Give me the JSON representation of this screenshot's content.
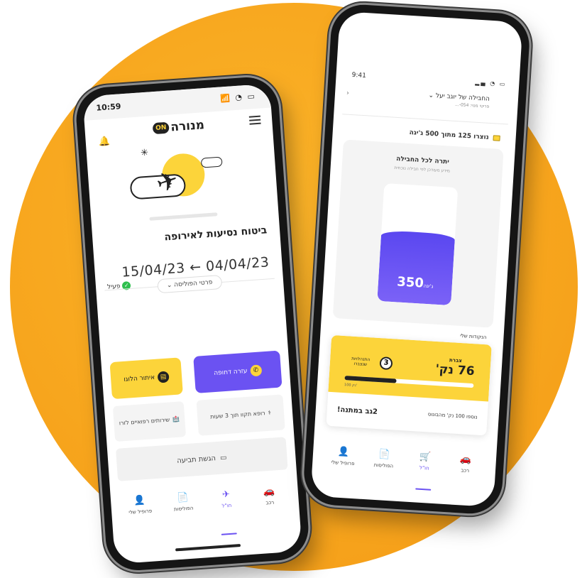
{
  "left": {
    "time": "10:59",
    "status_icons": "📶 ◔ ▭",
    "brand_name": "מנורה",
    "brand_badge": "ON",
    "policy_title": "ביטוח נסיעות לאירופה",
    "status_label": "פעיל",
    "dates": "15/04/23 ← 04/04/23",
    "policy_details": "פרטי הפוליסה ⌄",
    "urgent_help": "עזרה דחופה",
    "locate_flight": "איתור הלוגו",
    "doctor_tile": "רופא תקוו תוך 3 שעות",
    "medical_tile": "שירותים רפואיים לזרו",
    "claim": "הגשת תביעה",
    "nav": [
      {
        "label": "רכב",
        "icon": "car-icon",
        "glyph": "🚗",
        "active": false
      },
      {
        "label": "חו\"ל",
        "icon": "plane-icon",
        "glyph": "✈",
        "active": true
      },
      {
        "label": "הפוליסות",
        "icon": "document-icon",
        "glyph": "📄",
        "active": false
      },
      {
        "label": "פרופיל שלי",
        "icon": "person-icon",
        "glyph": "👤",
        "active": false
      }
    ]
  },
  "right": {
    "time": "9:41",
    "status_icons": "▂▄ ◔ ▭",
    "account_title": "החבילה של יוגב יעל ⌄",
    "account_sub": "פריטי מנוי: 054-...",
    "usage": "נוצרו 125 מתוך 500 ג'יגה",
    "panel_title": "יתרה לכל החבילה",
    "panel_sub": "מידע מעודכן לפי חבילה נוכחית",
    "remaining_value": "350",
    "remaining_unit": "ג'יגה",
    "remaining_fraction": 0.6,
    "points_label": "הנקודות שלי",
    "points_caption": "צברת",
    "points_value": "76 נק'",
    "badge_value": "3",
    "badge_text": "התנהלויות שנצברו",
    "progress_fraction": 0.4,
    "progress_label": "100 נק'",
    "gift_label": "2גב במתנה!",
    "gift_note": "נוספו 100 נק' מהבונוס",
    "nav": [
      {
        "label": "רכב",
        "icon": "car-icon",
        "glyph": "🚗",
        "active": false
      },
      {
        "label": "חו\"ל",
        "icon": "cart-icon",
        "glyph": "🛒",
        "active": true
      },
      {
        "label": "הפוליסות",
        "icon": "document-icon",
        "glyph": "📄",
        "active": false
      },
      {
        "label": "פרופיל שלי",
        "icon": "person-icon",
        "glyph": "👤",
        "active": false
      }
    ]
  }
}
